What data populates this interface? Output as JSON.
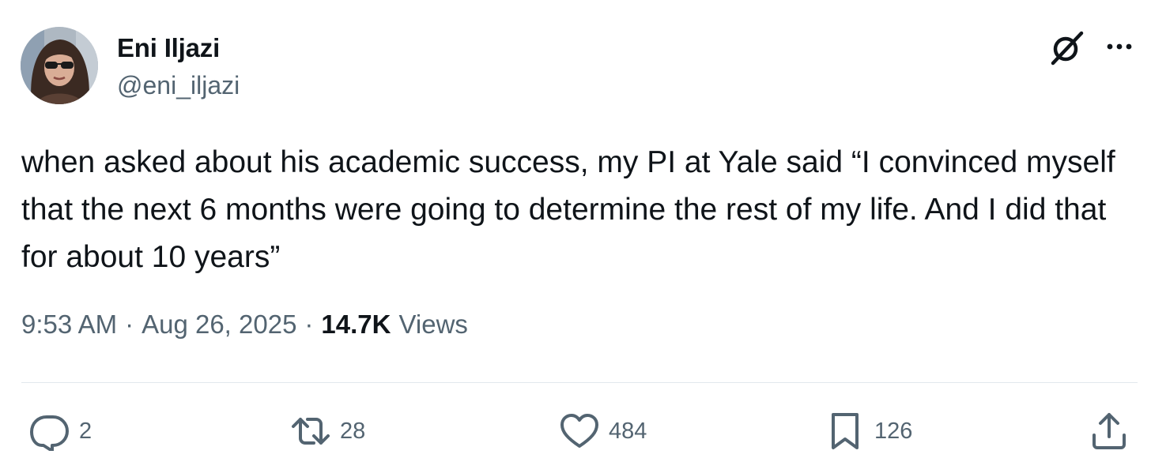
{
  "author": {
    "name": "Eni Iljazi",
    "handle": "@eni_iljazi"
  },
  "tweet": {
    "text": "when asked about his academic success, my PI at Yale said “I convinced myself that the next 6 months were going to determine the rest of my life. And I did that for about 10 years”",
    "time": "9:53 AM",
    "separator": "·",
    "date": "Aug 26, 2025",
    "views_count": "14.7K",
    "views_label": "Views"
  },
  "actions": {
    "replies": "2",
    "retweets": "28",
    "likes": "484",
    "bookmarks": "126"
  },
  "icons": {
    "header": [
      "grok-icon",
      "more-icon"
    ],
    "actions": [
      "reply-icon",
      "retweet-icon",
      "like-icon",
      "bookmark-icon",
      "share-icon"
    ]
  },
  "colors": {
    "text_primary": "#0f1419",
    "text_secondary": "#536471",
    "divider": "#e1e8ed"
  }
}
